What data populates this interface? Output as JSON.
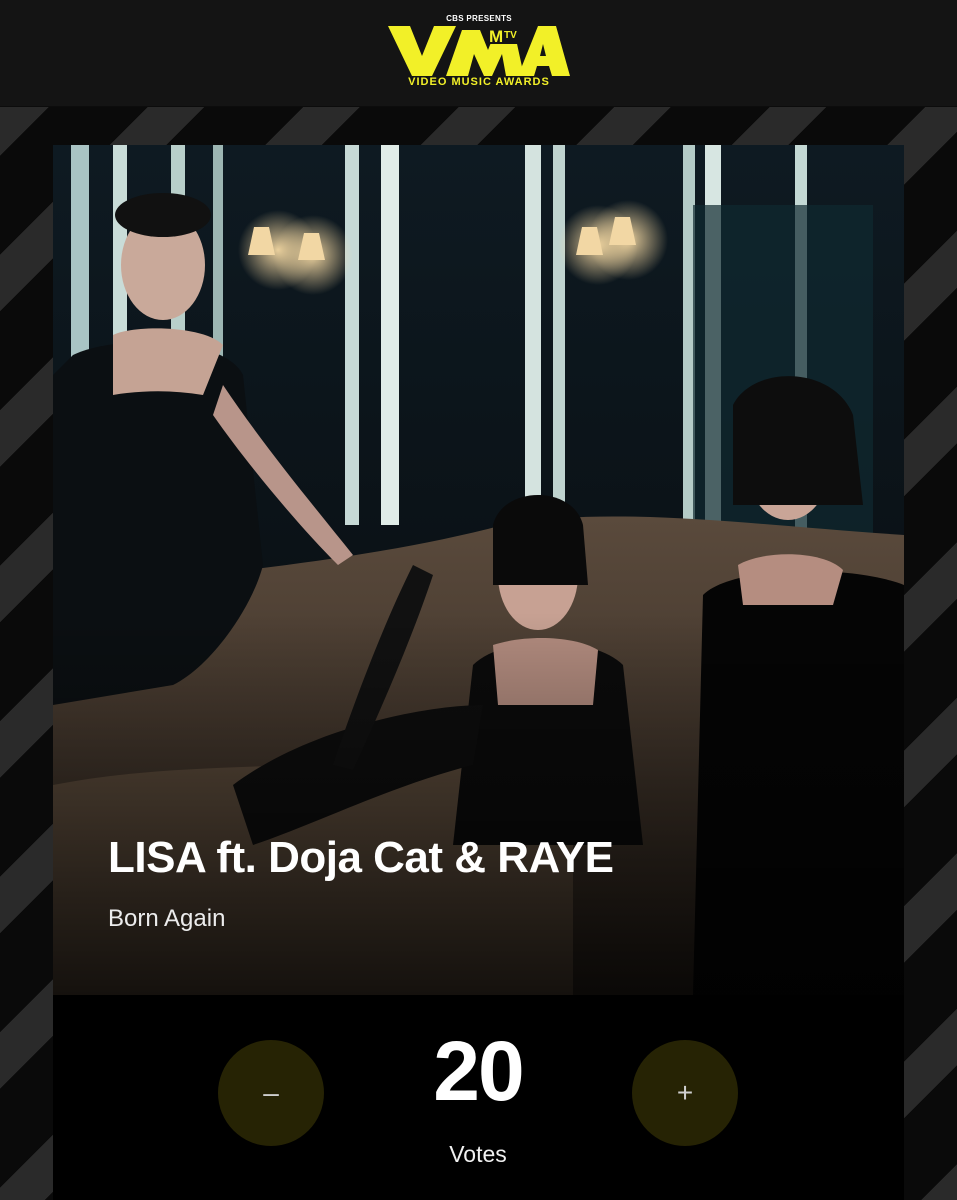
{
  "header": {
    "logo_presenter": "CBS PRESENTS",
    "logo_subtitle": "VIDEO MUSIC AWARDS",
    "logo_icon": "vma-mtv-logo",
    "brand_color": "#f2f028"
  },
  "nominee": {
    "artist": "LISA ft. Doja Cat & RAYE",
    "song": "Born Again",
    "image_icon": "music-video-still"
  },
  "voting": {
    "decrement_label": "–",
    "increment_label": "+",
    "count": "20",
    "count_label": "Votes",
    "button_color": "#262304"
  }
}
